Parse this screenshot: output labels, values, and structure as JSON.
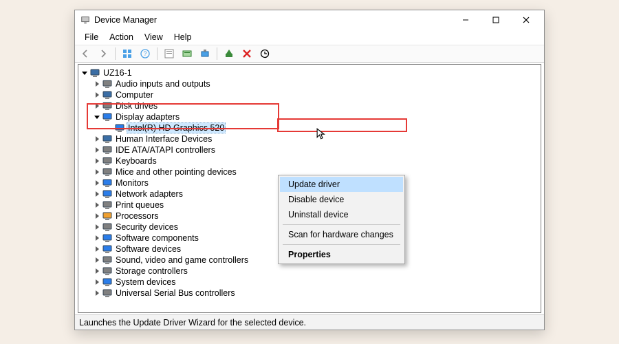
{
  "title": "Device Manager",
  "menus": {
    "file": "File",
    "action": "Action",
    "view": "View",
    "help": "Help"
  },
  "root_label": "UZ16-1",
  "categories": [
    {
      "id": "audio",
      "label": "Audio inputs and outputs"
    },
    {
      "id": "computer",
      "label": "Computer"
    },
    {
      "id": "disk",
      "label": "Disk drives"
    },
    {
      "id": "display",
      "label": "Display adapters",
      "expanded": true,
      "children": [
        {
          "id": "intel-hd-520",
          "label": "Intel(R) HD Graphics 520",
          "selected": true
        }
      ]
    },
    {
      "id": "hid",
      "label": "Human Interface Devices"
    },
    {
      "id": "ide",
      "label": "IDE ATA/ATAPI controllers"
    },
    {
      "id": "keyboards",
      "label": "Keyboards"
    },
    {
      "id": "mice",
      "label": "Mice and other pointing devices"
    },
    {
      "id": "monitors",
      "label": "Monitors"
    },
    {
      "id": "network",
      "label": "Network adapters"
    },
    {
      "id": "print",
      "label": "Print queues"
    },
    {
      "id": "cpu",
      "label": "Processors"
    },
    {
      "id": "security",
      "label": "Security devices"
    },
    {
      "id": "swcomp",
      "label": "Software components"
    },
    {
      "id": "swdev",
      "label": "Software devices"
    },
    {
      "id": "sound",
      "label": "Sound, video and game controllers"
    },
    {
      "id": "storage",
      "label": "Storage controllers"
    },
    {
      "id": "system",
      "label": "System devices"
    },
    {
      "id": "usb",
      "label": "Universal Serial Bus controllers"
    }
  ],
  "icon_colors": {
    "audio": "#808080",
    "computer": "#3b6ea5",
    "disk": "#808080",
    "display": "#2b7de9",
    "intel-hd-520": "#2b7de9",
    "hid": "#3b6ea5",
    "ide": "#808080",
    "keyboards": "#808080",
    "mice": "#808080",
    "monitors": "#2b7de9",
    "network": "#2b7de9",
    "print": "#808080",
    "cpu": "#f0a030",
    "security": "#808080",
    "swcomp": "#2b7de9",
    "swdev": "#2b7de9",
    "sound": "#808080",
    "storage": "#808080",
    "system": "#2b7de9",
    "usb": "#808080"
  },
  "context_menu": {
    "update": "Update driver",
    "disable": "Disable device",
    "uninstall": "Uninstall device",
    "scan": "Scan for hardware changes",
    "props": "Properties"
  },
  "status_text": "Launches the Update Driver Wizard for the selected device."
}
